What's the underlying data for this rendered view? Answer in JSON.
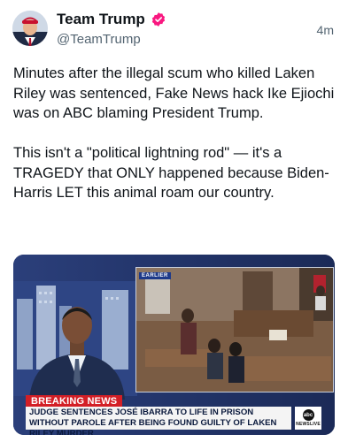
{
  "account": {
    "display_name": "Team Trump",
    "handle": "@TeamTrump",
    "verified_icon": "verified-badge-icon",
    "badge_color": "#f91880"
  },
  "post": {
    "timestamp": "4m",
    "text": "Minutes after the illegal scum who killed Laken Riley was sentenced, Fake News hack Ike Ejiochi was on ABC blaming President Trump.\n\nThis isn't a \"political lightning rod\" — it's a TRAGEDY that ONLY happened because Biden-Harris LET this animal roam our country."
  },
  "media": {
    "tag": "EARLIER",
    "breaking_label": "BREAKING NEWS",
    "headline": "JUDGE SENTENCES JOSÉ IBARRA TO LIFE IN PRISON WITHOUT PAROLE AFTER BEING FOUND GUILTY OF LAKEN RILEY MURDER",
    "network_logo_text": "abc",
    "network_sub": "NEWSLIVE",
    "colors": {
      "breaking_red": "#d31f26",
      "bar_navy": "#1b2a57"
    }
  }
}
